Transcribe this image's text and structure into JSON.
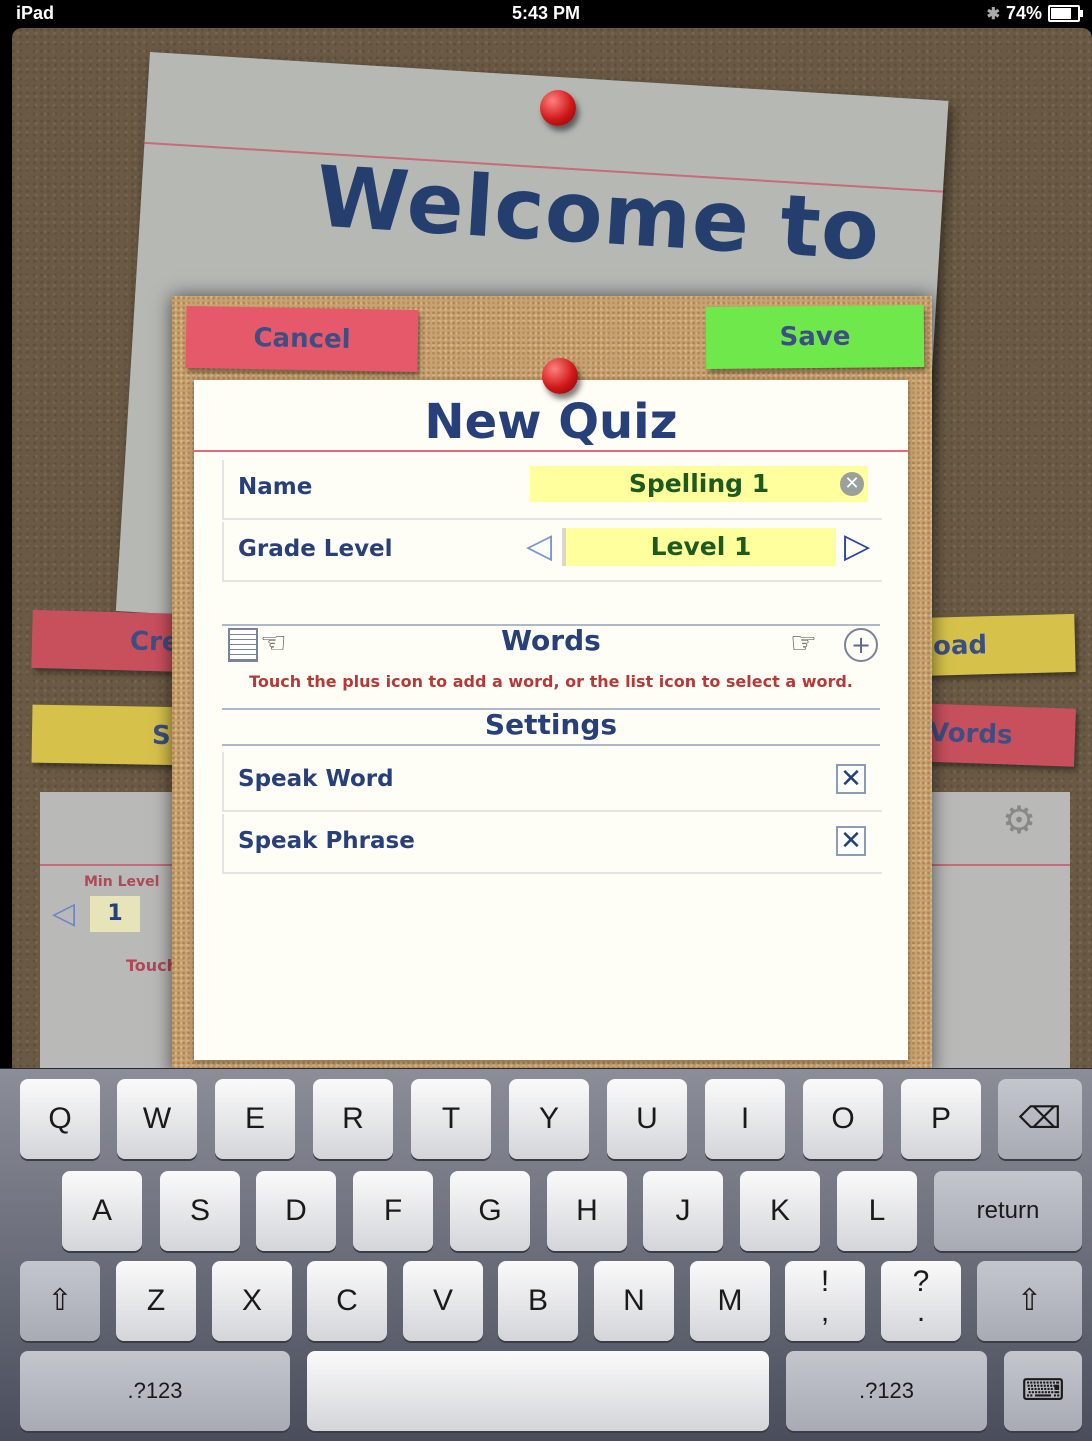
{
  "status_bar": {
    "device": "iPad",
    "time": "5:43 PM",
    "battery": "74%",
    "bluetooth_icon": "bluetooth-icon"
  },
  "background": {
    "welcome_text": "Welcome to",
    "notes": {
      "create_fragment": "Cre",
      "s_fragment": "S",
      "load_fragment": "oad",
      "words_fragment": "Vords"
    },
    "min_level_label": "Min Level",
    "min_level_value": "1",
    "touch_fragment": "Touch"
  },
  "modal": {
    "cancel_label": "Cancel",
    "save_label": "Save",
    "title": "New Quiz",
    "name_label": "Name",
    "name_value": "Spelling 1",
    "grade_label": "Grade Level",
    "grade_value": "Level 1",
    "words_heading": "Words",
    "words_hint": "Touch the plus icon to add a word, or the list icon to select a word.",
    "settings_heading": "Settings",
    "speak_word_label": "Speak Word",
    "speak_word_checked": "✕",
    "speak_phrase_label": "Speak Phrase",
    "speak_phrase_checked": "✕"
  },
  "keyboard": {
    "row1": [
      "Q",
      "W",
      "E",
      "R",
      "T",
      "Y",
      "U",
      "I",
      "O",
      "P"
    ],
    "row2": [
      "A",
      "S",
      "D",
      "F",
      "G",
      "H",
      "J",
      "K",
      "L"
    ],
    "row3": [
      "Z",
      "X",
      "C",
      "V",
      "B",
      "N",
      "M"
    ],
    "exclaim": "!",
    "comma": ",",
    "question": "?",
    "period": ".",
    "return_label": "return",
    "numbers_left": ".?123",
    "numbers_right": ".?123",
    "delete_icon": "⌫",
    "shift_icon": "⇧",
    "hide_keyboard_icon": "⌨"
  },
  "colors": {
    "navy_text": "#28407a",
    "green_text": "#1e5a1e",
    "save_green": "#6ee84a",
    "cancel_red": "#e5596a",
    "field_yellow": "#ffff9e"
  }
}
